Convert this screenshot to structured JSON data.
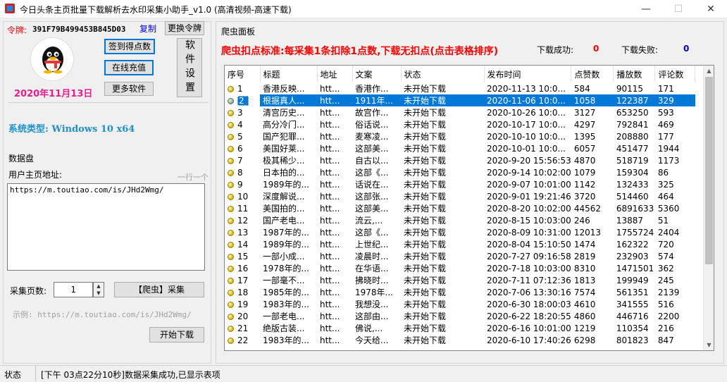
{
  "window": {
    "title": "今日头条主页批量下载解析去水印采集小助手_v1.0 (高清视频-高速下载)",
    "min": "—",
    "max": "☐",
    "close": "✕"
  },
  "left": {
    "token_label": "令牌:",
    "token_value": "391F79B499453B845D03",
    "copy_link": "复制",
    "change_token_btn": "更换令牌",
    "signin_btn": "签到得点数",
    "recharge_btn": "在线充值",
    "more_btn": "更多软件",
    "software_settings_btn": "软件设置",
    "date": "2020年11月13日",
    "system_type": "系统类型: Windows 10  x64",
    "data_panel_title": "数据盘",
    "user_url_label": "用户主页地址:",
    "one_per_line": "一行一个",
    "url_text": "https://m.toutiao.com/is/JHd2Wmg/",
    "pages_label": "采集页数:",
    "pages_value": "1",
    "crawl_btn": "【爬虫】采集",
    "example": "示例: https://m.toutiao.com/is/JHd2Wmg/",
    "start_download_btn": "开始下载"
  },
  "right": {
    "panel_title": "爬虫面板",
    "deduction_rule": "爬虫扣点标准:每采集1条扣除1点数,下载无扣点(点击表格排序)",
    "success_label": "下载成功:",
    "success_count": "0",
    "fail_label": "下载失败:",
    "fail_count": "0"
  },
  "table": {
    "headers": [
      "序号",
      "标题",
      "地址",
      "文案",
      "状态",
      "发布时间",
      "点赞数",
      "播放数",
      "评论数"
    ],
    "selected_row": 1,
    "rows": [
      [
        "1",
        "香港反映...",
        "htt...",
        "香港作...",
        "未开始下载",
        "2020-11-13 10:0...",
        "584",
        "90115",
        "171"
      ],
      [
        "2",
        "根据真人...",
        "htt...",
        "1911年...",
        "未开始下载",
        "2020-11-06 10:0...",
        "1058",
        "122387",
        "329"
      ],
      [
        "3",
        "清宫历史...",
        "htt...",
        "故宫作...",
        "未开始下载",
        "2020-10-26 10:0...",
        "3127",
        "653250",
        "593"
      ],
      [
        "4",
        "高分冷门...",
        "htt...",
        "俗话说...",
        "未开始下载",
        "2020-10-17 10:0...",
        "4297",
        "792841",
        "469"
      ],
      [
        "5",
        "国产犯罪...",
        "htt...",
        "麦寒凌...",
        "未开始下载",
        "2020-10-10 10:0...",
        "1395",
        "208880",
        "177"
      ],
      [
        "6",
        "美国好莱...",
        "htt...",
        "这部美...",
        "未开始下载",
        "2020-10-01 10:0...",
        "6057",
        "451477",
        "1944"
      ],
      [
        "7",
        "极其稀少...",
        "htt...",
        "自古以...",
        "未开始下载",
        "2020-9-20 15:56:53",
        "4870",
        "518719",
        "1173"
      ],
      [
        "8",
        "日本拍的...",
        "htt...",
        "这部《...",
        "未开始下载",
        "2020-9-14 10:02:00",
        "1079",
        "159304",
        "86"
      ],
      [
        "9",
        "1989年的...",
        "htt...",
        "话说在...",
        "未开始下载",
        "2020-9-07 10:01:00",
        "1142",
        "132433",
        "325"
      ],
      [
        "10",
        "深度解说...",
        "htt...",
        "这部张...",
        "未开始下载",
        "2020-9-01 19:21:46",
        "3720",
        "514460",
        "464"
      ],
      [
        "11",
        "美国拍的...",
        "htt...",
        "这部美...",
        "未开始下载",
        "2020-8-20 10:02:00",
        "44562",
        "6891633",
        "5360"
      ],
      [
        "12",
        "国产老电...",
        "htt...",
        "流云,...",
        "未开始下载",
        "2020-8-15 10:03:00",
        "246",
        "13887",
        "51"
      ],
      [
        "13",
        "1987年的...",
        "htt...",
        "这部《...",
        "未开始下载",
        "2020-8-09 10:31:00",
        "12013",
        "1755724",
        "2404"
      ],
      [
        "14",
        "1989年的...",
        "htt...",
        "上世纪...",
        "未开始下载",
        "2020-8-04 15:10:50",
        "1474",
        "162322",
        "720"
      ],
      [
        "15",
        "一部小成...",
        "htt...",
        "凌晨时...",
        "未开始下载",
        "2020-7-27 09:16:58",
        "2819",
        "232903",
        "574"
      ],
      [
        "16",
        "1978年的...",
        "htt...",
        "在华语...",
        "未开始下载",
        "2020-7-18 10:03:00",
        "8310",
        "1471501",
        "362"
      ],
      [
        "17",
        "一部毫不...",
        "htt...",
        "拂晓时...",
        "未开始下载",
        "2020-7-11 07:12:36",
        "1813",
        "199949",
        "245"
      ],
      [
        "18",
        "1985年的...",
        "htt...",
        "1978年...",
        "未开始下载",
        "2020-7-06 13:30:16",
        "7574",
        "561351",
        "2139"
      ],
      [
        "19",
        "1983年的...",
        "htt...",
        "我想没...",
        "未开始下载",
        "2020-6-30 18:00:03",
        "4610",
        "341555",
        "516"
      ],
      [
        "20",
        "一部老电...",
        "htt...",
        "这部由...",
        "未开始下载",
        "2020-6-22 18:20:55",
        "4860",
        "446716",
        "2200"
      ],
      [
        "21",
        "绝版古装...",
        "htt...",
        "佛说,...",
        "未开始下载",
        "2020-6-16 10:01:00",
        "1219",
        "110354",
        "216"
      ],
      [
        "22",
        "1983年的...",
        "htt...",
        "今天给...",
        "未开始下载",
        "2020-6-10 17:40:26",
        "6298",
        "801823",
        "847"
      ]
    ]
  },
  "status": {
    "label": "状态",
    "message": "[下午 03点22分10秒]数据采集成功,已显示表项"
  }
}
